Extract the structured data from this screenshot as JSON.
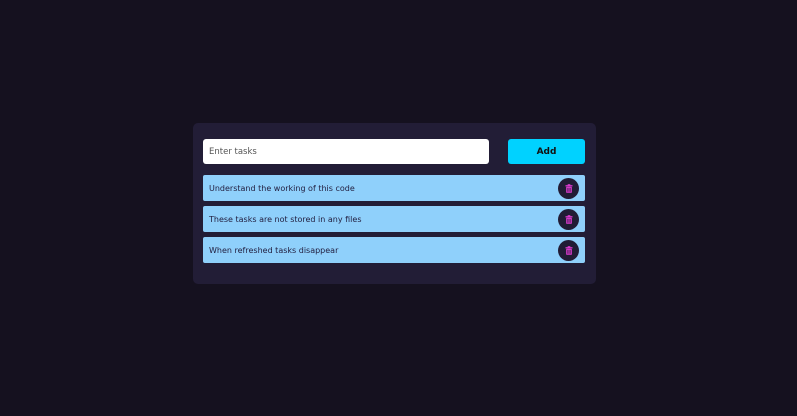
{
  "form": {
    "input_value": "",
    "input_placeholder": "Enter tasks",
    "add_label": "Add"
  },
  "tasks": [
    {
      "text": "Understand the working of this code",
      "icon": "trash-icon"
    },
    {
      "text": "These tasks are not stored in any files",
      "icon": "trash-icon"
    },
    {
      "text": "When refreshed tasks disappear",
      "icon": "trash-icon"
    }
  ],
  "colors": {
    "background": "#15111f",
    "card": "#221d36",
    "accent": "#00d2ff",
    "task_item": "#8fd0fb",
    "delete_icon": "#e23bd4"
  }
}
